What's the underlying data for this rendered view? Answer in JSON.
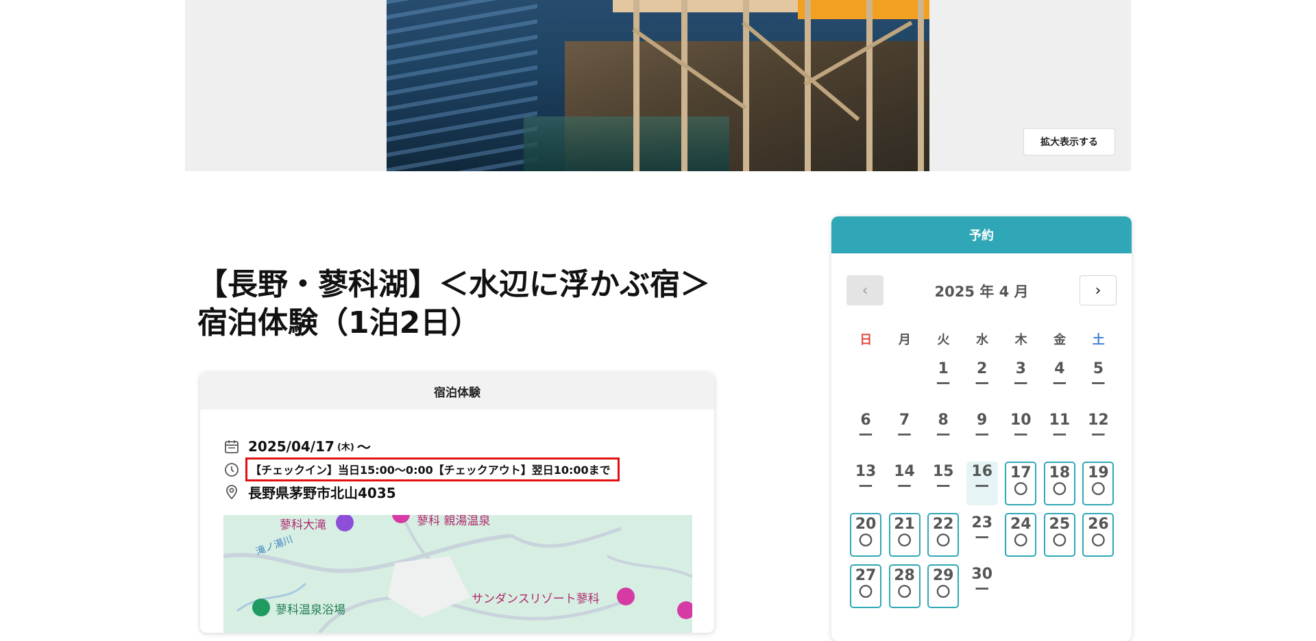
{
  "hero": {
    "zoom_label": "拡大表示する"
  },
  "title": "【長野・蓼科湖】＜水辺に浮かぶ宿＞宿泊体験（1泊2日）",
  "card": {
    "header": "宿泊体験",
    "date": "2025/04/17",
    "date_dow": "(木)",
    "date_suffix": "〜",
    "time": "【チェックイン】当日15:00〜0:00【チェックアウト】翌日10:00まで",
    "address": "長野県茅野市北山4035",
    "map_labels": {
      "waterfall": "蓼科大滝",
      "onsen_top": "蓼科 親湯温泉",
      "river": "滝ノ湯川",
      "onsen_bath": "蓼科温泉浴場",
      "resort": "サンダンスリゾート蓼科"
    }
  },
  "panel": {
    "header": "予約",
    "month": "2025 年 4 月",
    "prev_icon": "chevron-left-icon",
    "next_icon": "chevron-right-icon",
    "weekdays": [
      "日",
      "月",
      "火",
      "水",
      "木",
      "金",
      "土"
    ],
    "weekday_colors": {
      "sun": "#e0483c",
      "sat": "#3d82d1"
    },
    "accent": "#2fa7b6",
    "days": [
      {
        "d": "",
        "m": ""
      },
      {
        "d": "",
        "m": ""
      },
      {
        "d": "1",
        "m": "ー"
      },
      {
        "d": "2",
        "m": "ー"
      },
      {
        "d": "3",
        "m": "ー"
      },
      {
        "d": "4",
        "m": "ー"
      },
      {
        "d": "5",
        "m": "ー"
      },
      {
        "d": "6",
        "m": "ー"
      },
      {
        "d": "7",
        "m": "ー"
      },
      {
        "d": "8",
        "m": "ー"
      },
      {
        "d": "9",
        "m": "ー"
      },
      {
        "d": "10",
        "m": "ー"
      },
      {
        "d": "11",
        "m": "ー"
      },
      {
        "d": "12",
        "m": "ー"
      },
      {
        "d": "13",
        "m": "ー"
      },
      {
        "d": "14",
        "m": "ー"
      },
      {
        "d": "15",
        "m": "ー"
      },
      {
        "d": "16",
        "m": "ー",
        "today": true
      },
      {
        "d": "17",
        "m": "〇",
        "avail": true
      },
      {
        "d": "18",
        "m": "〇",
        "avail": true
      },
      {
        "d": "19",
        "m": "〇",
        "avail": true
      },
      {
        "d": "20",
        "m": "〇",
        "avail": true
      },
      {
        "d": "21",
        "m": "〇",
        "avail": true
      },
      {
        "d": "22",
        "m": "〇",
        "avail": true
      },
      {
        "d": "23",
        "m": "ー"
      },
      {
        "d": "24",
        "m": "〇",
        "avail": true
      },
      {
        "d": "25",
        "m": "〇",
        "avail": true
      },
      {
        "d": "26",
        "m": "〇",
        "avail": true
      },
      {
        "d": "27",
        "m": "〇",
        "avail": true
      },
      {
        "d": "28",
        "m": "〇",
        "avail": true
      },
      {
        "d": "29",
        "m": "〇",
        "avail": true
      },
      {
        "d": "30",
        "m": "ー"
      }
    ]
  }
}
